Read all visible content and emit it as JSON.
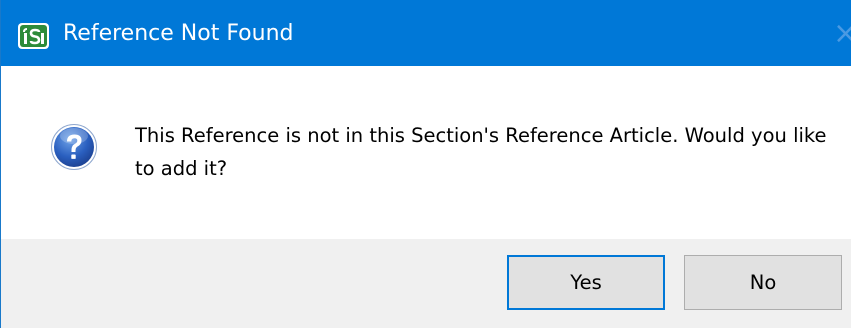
{
  "window": {
    "title": "Reference Not Found",
    "app_icon": "isi-logo-icon",
    "close_icon": "close-icon",
    "close_glyph": "×"
  },
  "dialog": {
    "icon": "question-icon",
    "message": "This Reference is not in this Section's Reference Article.  Would you like to add it?"
  },
  "buttons": {
    "yes_label": "Yes",
    "no_label": "No"
  },
  "colors": {
    "titlebar": "#0078d7",
    "footer": "#f0f0f0",
    "button_face": "#e1e1e1",
    "focus_border": "#0078d7"
  }
}
